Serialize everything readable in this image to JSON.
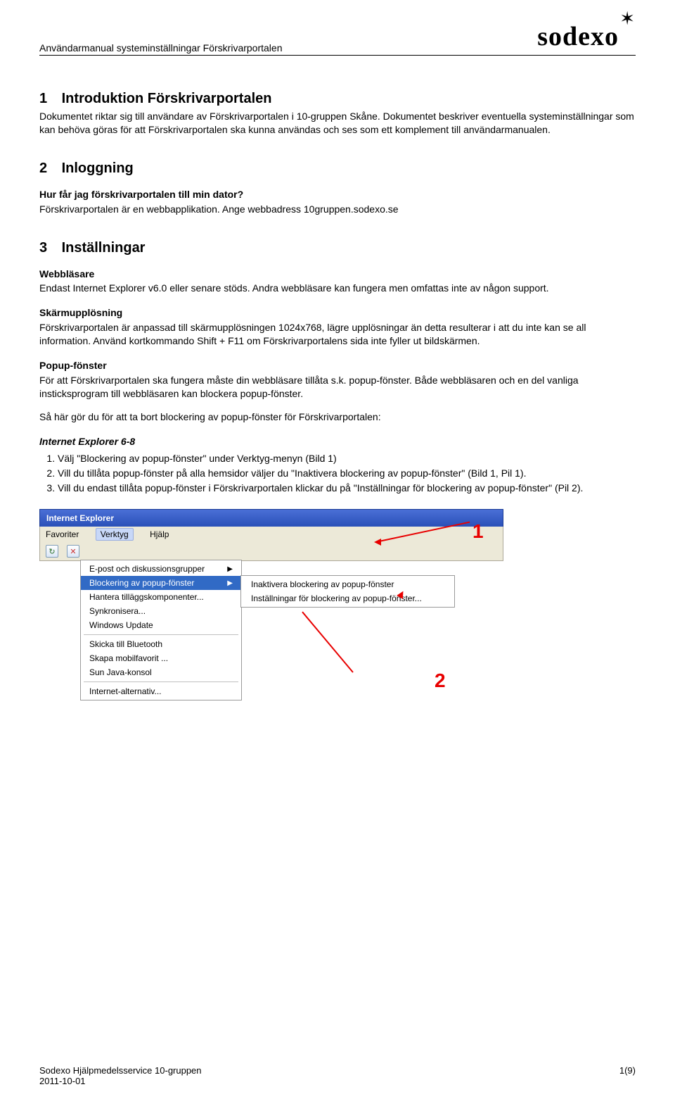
{
  "header": {
    "title": "Användarmanual systeminställningar Förskrivarportalen",
    "logo_text": "sodexo",
    "logo_glyph": "✶"
  },
  "section1": {
    "num": "1",
    "title": "Introduktion Förskrivarportalen",
    "p1": "Dokumentet riktar sig till användare av Förskrivarportalen i 10-gruppen Skåne. Dokumentet beskriver eventuella systeminställningar som kan behöva göras för att Förskrivarportalen ska kunna användas och ses som ett komplement till användarmanualen."
  },
  "section2": {
    "num": "2",
    "title": "Inloggning",
    "q": "Hur får jag förskrivarportalen till min dator?",
    "a": "Förskrivarportalen är en webbapplikation. Ange webbadress 10gruppen.sodexo.se"
  },
  "section3": {
    "num": "3",
    "title": "Inställningar",
    "browser_h": "Webbläsare",
    "browser_p": "Endast Internet Explorer v6.0 eller senare stöds. Andra webbläsare kan fungera men omfattas inte av någon support.",
    "res_h": "Skärmupplösning",
    "res_p": "Förskrivarportalen är anpassad till skärmupplösningen 1024x768, lägre upplösningar än detta resulterar i att du inte kan se all information. Använd kortkommando Shift + F11 om Förskrivarportalens sida inte fyller ut bildskärmen.",
    "popup_h": "Popup-fönster",
    "popup_p": "För att Förskrivarportalen ska fungera måste din webbläsare tillåta s.k. popup-fönster. Både webbläsaren och en del vanliga insticksprogram till webbläsaren kan blockera popup-fönster.",
    "popup_howto": "Så här gör du för att ta bort blockering av popup-fönster för Förskrivarportalen:",
    "ie68": "Internet Explorer 6-8",
    "steps": [
      "Välj \"Blockering av popup-fönster\" under Verktyg-menyn (Bild 1)",
      "Vill du tillåta popup-fönster på alla hemsidor väljer du \"Inaktivera blockering av popup-fönster\" (Bild 1, Pil 1).",
      "Vill du endast tillåta popup-fönster i Förskrivarportalen klickar du på \"Inställningar för blockering av popup-fönster\" (Pil 2)."
    ]
  },
  "ie": {
    "title": "Internet Explorer",
    "menus": {
      "fav": "Favoriter",
      "tools": "Verktyg",
      "help": "Hjälp"
    },
    "dropdown": [
      "E-post och diskussionsgrupper",
      "Blockering av popup-fönster",
      "Hantera tilläggskomponenter...",
      "Synkronisera...",
      "Windows Update",
      "Skicka till Bluetooth",
      "Skapa mobilfavorit ...",
      "Sun Java-konsol",
      "Internet-alternativ..."
    ],
    "sub": [
      "Inaktivera blockering av popup-fönster",
      "Inställningar för blockering av popup-fönster..."
    ],
    "callouts": {
      "one": "1",
      "two": "2"
    }
  },
  "footer": {
    "left_line1": "Sodexo Hjälpmedelsservice 10-gruppen",
    "left_line2": "2011-10-01",
    "page": "1(9)"
  }
}
